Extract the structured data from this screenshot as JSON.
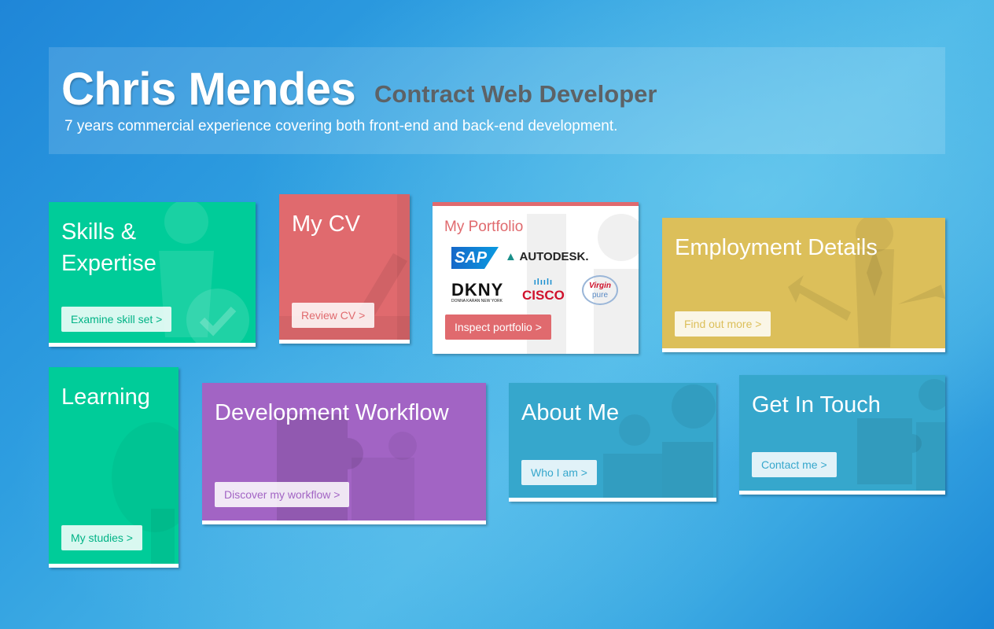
{
  "header": {
    "name": "Chris Mendes",
    "role": "Contract Web Developer",
    "description": "7 years commercial experience covering both front-end and back-end development."
  },
  "tiles": {
    "skills": {
      "title_line1": "Skills &",
      "title_line2": "Expertise",
      "button": "Examine skill set >",
      "color": "#00cc99"
    },
    "cv": {
      "title": "My CV",
      "button": "Review CV >",
      "color": "#e06a6e"
    },
    "portfolio": {
      "title": "My Portfolio",
      "button": "Inspect portfolio >",
      "color": "#e06a6e",
      "logos": [
        "SAP",
        "AUTODESK.",
        "DKNY",
        "DONNA KARAN NEW YORK",
        "CISCO",
        "Virgin",
        "pure"
      ]
    },
    "employment": {
      "title": "Employment Details",
      "button": "Find out more >",
      "color": "#dcbf5a"
    },
    "learning": {
      "title": "Learning",
      "button": "My studies >",
      "color": "#00cc99"
    },
    "workflow": {
      "title": "Development Workflow",
      "button": "Discover my workflow >",
      "color": "#a264c4"
    },
    "about": {
      "title": "About Me",
      "button": "Who I am >",
      "color": "#36a7cc"
    },
    "touch": {
      "title": "Get In Touch",
      "button": "Contact me >",
      "color": "#36a7cc"
    }
  }
}
